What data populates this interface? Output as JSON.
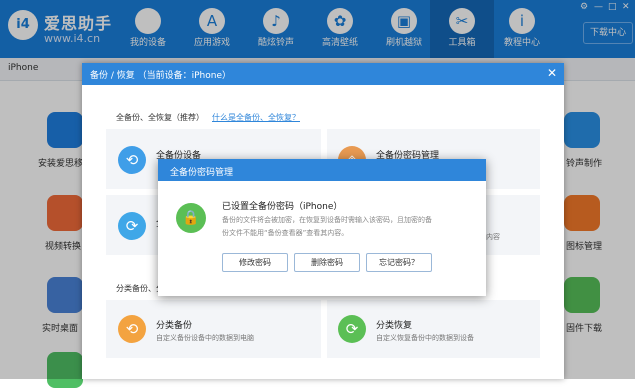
{
  "app": {
    "logo_badge": "i4",
    "name": "爱思助手",
    "url": "www.i4.cn"
  },
  "nav": [
    {
      "label": "我的设备",
      "icon": "apple-icon",
      "glyph": ""
    },
    {
      "label": "应用游戏",
      "icon": "app-store-icon",
      "glyph": "A"
    },
    {
      "label": "酷炫铃声",
      "icon": "bell-icon",
      "glyph": "♪"
    },
    {
      "label": "高清壁纸",
      "icon": "flower-icon",
      "glyph": "✿"
    },
    {
      "label": "刷机越狱",
      "icon": "box-icon",
      "glyph": "▣"
    },
    {
      "label": "工具箱",
      "icon": "tools-icon",
      "glyph": "✂"
    },
    {
      "label": "教程中心",
      "icon": "info-icon",
      "glyph": "i"
    }
  ],
  "download_label": "下载中心",
  "window_controls": [
    "⚙",
    "—",
    "□",
    "✕"
  ],
  "device_tab": "iPhone",
  "background": {
    "left_labels": [
      "安装爱思移",
      "视频转换",
      "实时桌面"
    ],
    "right_labels": [
      "铃声制作",
      "图标管理",
      "固件下载"
    ]
  },
  "backup_dialog": {
    "title": "备份 / 恢复  （当前设备：iPhone）",
    "close": "✕",
    "section1": "全备份、全恢复（推荐）",
    "section1_link": "什么是全备份、全恢复？",
    "section2": "分类备份、分",
    "cards": {
      "full_backup": {
        "title": "全备份设备",
        "desc": "",
        "icon": "clock-backup-icon"
      },
      "password_manage": {
        "title": "全备份密码管理",
        "desc": "",
        "icon": "shield-icon"
      },
      "full_restore": {
        "title": "全",
        "desc": "",
        "icon": "restore-icon"
      },
      "right_partial": {
        "title": "",
        "desc": "内容",
        "icon": "green-icon"
      },
      "category_backup": {
        "title": "分类备份",
        "desc": "自定义备份设备中的数据到电脑",
        "icon": "category-backup-icon"
      },
      "category_restore": {
        "title": "分类恢复",
        "desc": "自定义恢复备份中的数据到设备",
        "icon": "category-restore-icon"
      }
    }
  },
  "password_dialog": {
    "title": "全备份密码管理",
    "heading": "已设置全备份密码（iPhone）",
    "desc_lines": [
      "备份的文件将会被加密，在恢复到设备时需输入该密码，且加密的备",
      "份文件不能用“备份查看器”查看其内容。"
    ],
    "buttons": [
      "修改密码",
      "删除密码",
      "忘记密码？"
    ],
    "lock_glyph": "🔒"
  },
  "colors": {
    "brand_blue": "#1a7fdb",
    "dialog_blue": "#2f86da",
    "lock_green": "#5bbf55"
  }
}
